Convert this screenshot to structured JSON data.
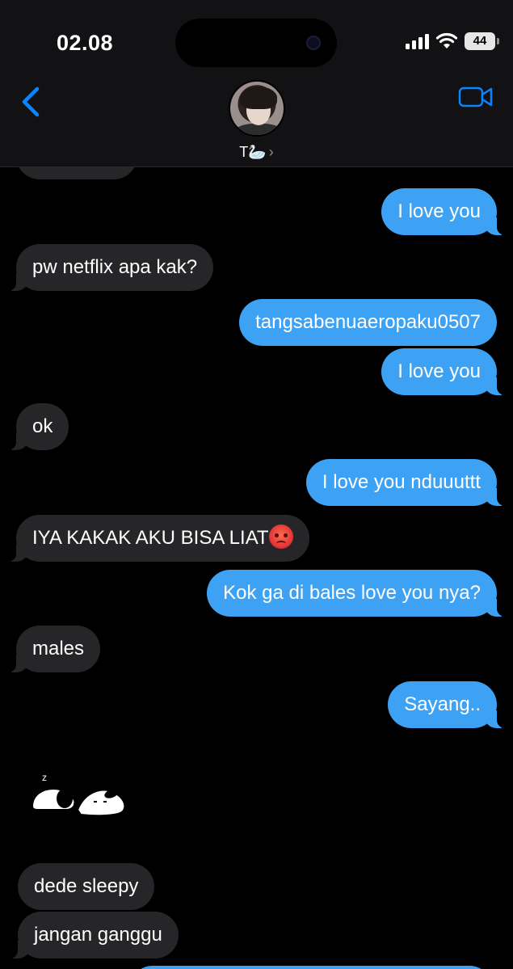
{
  "status_bar": {
    "time": "02.08",
    "battery": "44"
  },
  "header": {
    "contact_name": "T🦢"
  },
  "messages": [
    {
      "dir": "in",
      "text": "pw netflix apa kak?"
    },
    {
      "dir": "out",
      "text": "I love you"
    },
    {
      "dir": "out",
      "text": "tangsabenuaeropaku0507"
    },
    {
      "dir": "out",
      "text": "I love you"
    },
    {
      "dir": "in",
      "text": "ok"
    },
    {
      "dir": "out",
      "text": "I love you nduuuttt"
    },
    {
      "dir": "in",
      "text": "IYA KAKAK AKU BISA LIAT"
    },
    {
      "dir": "out",
      "text": "Kok ga di bales love you nya?"
    },
    {
      "dir": "in",
      "text": "males"
    },
    {
      "dir": "out",
      "text": "Sayang.."
    },
    {
      "dir": "in",
      "text": "dede sleepy"
    },
    {
      "dir": "in",
      "text": "jangan ganggu"
    }
  ],
  "sticker": {
    "name": "sleeping-snoopy-sticker",
    "glyph": "z"
  },
  "icons": [
    "back-chevron-icon",
    "facetime-video-icon",
    "signal-icon",
    "wifi-icon",
    "battery-icon",
    "angry-face-emoji"
  ],
  "colors": {
    "outgoing": "#3ea2f4",
    "incoming": "#262628",
    "accent": "#0a84ff"
  }
}
